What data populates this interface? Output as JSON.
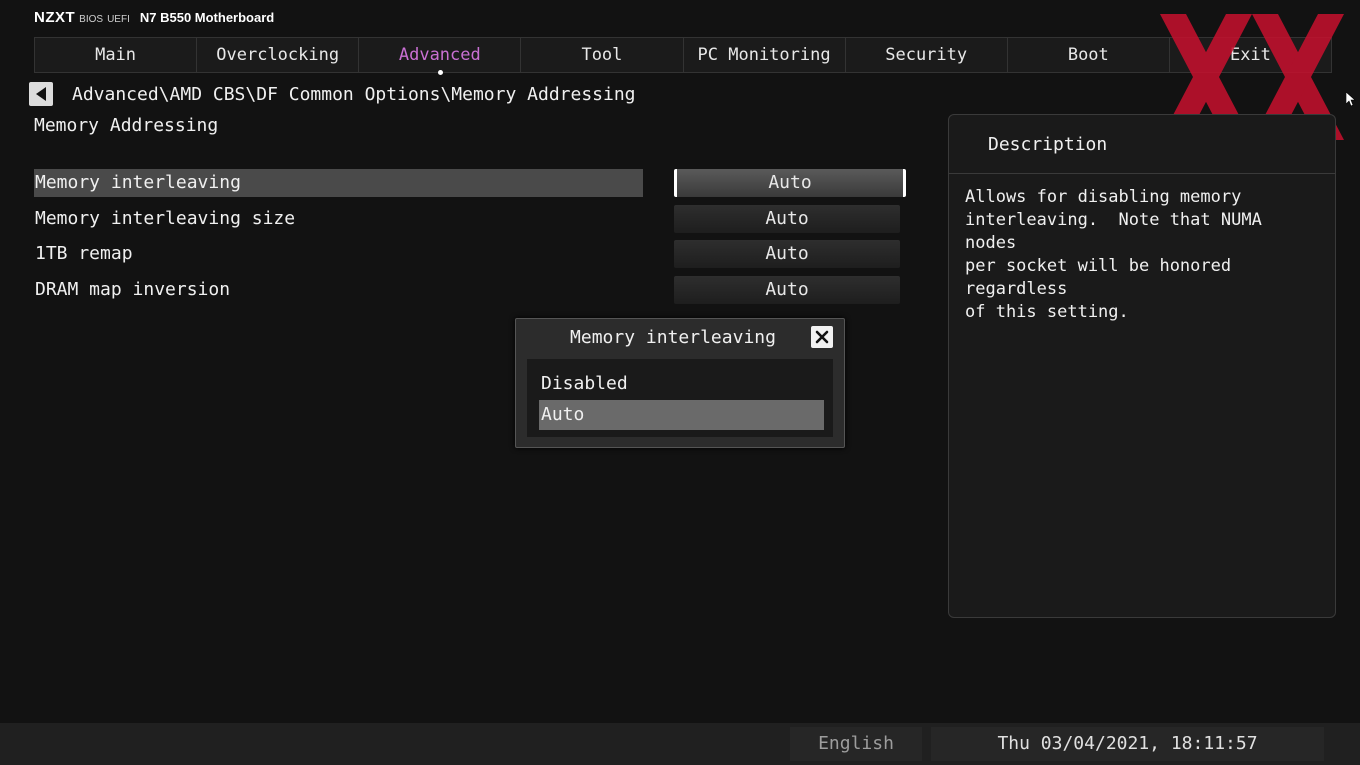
{
  "brand": {
    "logo": "NZXT",
    "bios": "BIOS",
    "uefi": "UEFI",
    "model": "N7 B550 Motherboard"
  },
  "tabs": [
    {
      "label": "Main"
    },
    {
      "label": "Overclocking"
    },
    {
      "label": "Advanced"
    },
    {
      "label": "Tool"
    },
    {
      "label": "PC Monitoring"
    },
    {
      "label": "Security"
    },
    {
      "label": "Boot"
    },
    {
      "label": "Exit"
    }
  ],
  "active_tab": "Advanced",
  "breadcrumb": "Advanced\\AMD CBS\\DF Common Options\\Memory Addressing",
  "page_title": "Memory Addressing",
  "settings": [
    {
      "label": "Memory interleaving",
      "value": "Auto"
    },
    {
      "label": "Memory interleaving size",
      "value": "Auto"
    },
    {
      "label": "1TB remap",
      "value": "Auto"
    },
    {
      "label": "DRAM map inversion",
      "value": "Auto"
    }
  ],
  "description": {
    "header": "Description",
    "text": "Allows for disabling memory\ninterleaving.  Note that NUMA nodes\nper socket will be honored regardless\nof this setting."
  },
  "dialog": {
    "title": "Memory interleaving",
    "options": [
      {
        "label": "Disabled"
      },
      {
        "label": "Auto"
      }
    ],
    "selected": "Auto"
  },
  "footer": {
    "language": "English",
    "datetime": "Thu 03/04/2021, 18:11:57"
  },
  "colors": {
    "accent": "#c970d3",
    "watermark": "#c8102e"
  },
  "icons": {
    "back": "back-arrow-icon",
    "close": "close-icon",
    "watermark": "hardwareluxx-logo-icon",
    "cursor": "mouse-cursor-icon"
  }
}
